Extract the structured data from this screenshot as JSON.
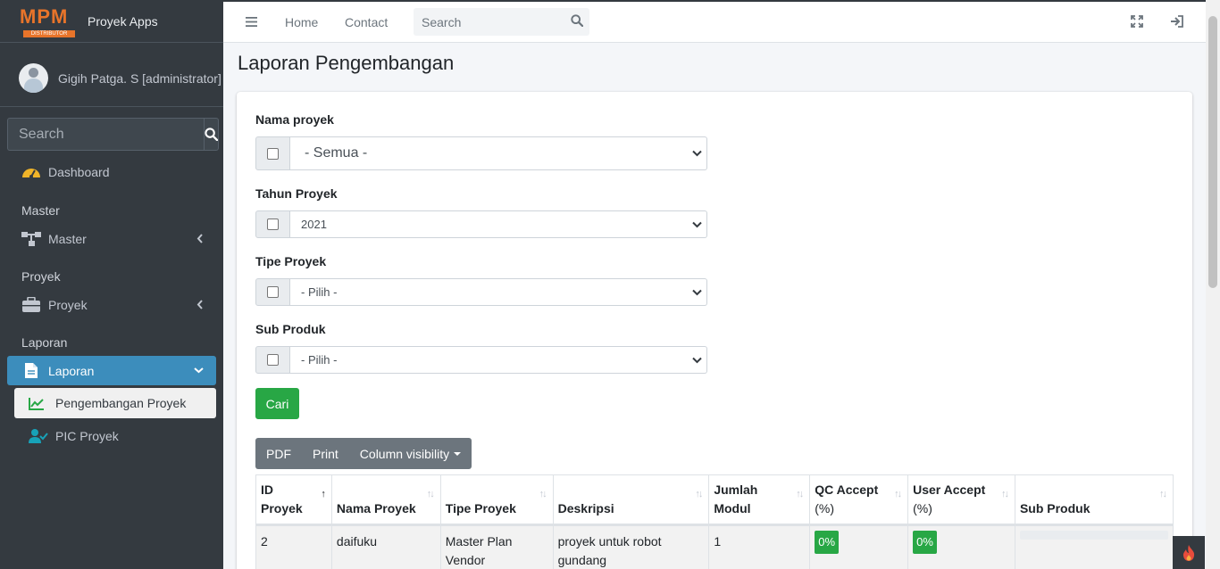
{
  "brand": {
    "logo_text": "MPM",
    "logo_sub": "DISTRIBUTOR",
    "app_name": "Proyek Apps"
  },
  "user": {
    "name": "Gigih Patga. S [administrator]"
  },
  "sidebar": {
    "search_placeholder": "Search",
    "dashboard": "Dashboard",
    "master_header": "Master",
    "master_item": "Master",
    "proyek_header": "Proyek",
    "proyek_item": "Proyek",
    "laporan_header": "Laporan",
    "laporan_item": "Laporan",
    "sub_items": [
      "Pengembangan Proyek",
      "PIC Proyek"
    ]
  },
  "topbar": {
    "home": "Home",
    "contact": "Contact",
    "search_placeholder": "Search"
  },
  "page": {
    "title": "Laporan Pengembangan"
  },
  "filters": {
    "nama_proyek": {
      "label": "Nama proyek",
      "value": "- Semua -"
    },
    "tahun_proyek": {
      "label": "Tahun Proyek",
      "value": "2021"
    },
    "tipe_proyek": {
      "label": "Tipe Proyek",
      "value": "- Pilih -"
    },
    "sub_produk": {
      "label": "Sub Produk",
      "value": "- Pilih -"
    },
    "submit": "Cari"
  },
  "table_buttons": {
    "pdf": "PDF",
    "print": "Print",
    "column_visibility": "Column visibility"
  },
  "table": {
    "headers": [
      [
        "ID",
        "Proyek"
      ],
      [
        "",
        "Nama Proyek"
      ],
      [
        "",
        "Tipe Proyek"
      ],
      [
        "",
        "Deskripsi"
      ],
      [
        "Jumlah",
        "Modul"
      ],
      [
        "QC Accept",
        "(%)"
      ],
      [
        "User Accept",
        "(%)"
      ],
      [
        "",
        "Sub Produk"
      ]
    ],
    "rows": [
      {
        "id": "2",
        "nama": "daifuku",
        "tipe": "Master Plan Vendor",
        "deskripsi": "proyek untuk robot gundang",
        "jumlah_modul": "1",
        "qc_accept": "0%",
        "user_accept": "0%",
        "sub_produk": ""
      }
    ]
  },
  "colors": {
    "sidebar": "#343a40",
    "accent": "#3c8dbc",
    "success": "#28a745",
    "logo": "#e8742a"
  },
  "icons": [
    "hamburger-icon",
    "search-icon",
    "expand-icon",
    "sign-out-icon",
    "tachometer-icon",
    "sitemap-icon",
    "briefcase-icon",
    "file-icon",
    "chart-line-icon",
    "user-check-icon",
    "chevron-left-icon",
    "chevron-down-icon",
    "fire-icon"
  ]
}
